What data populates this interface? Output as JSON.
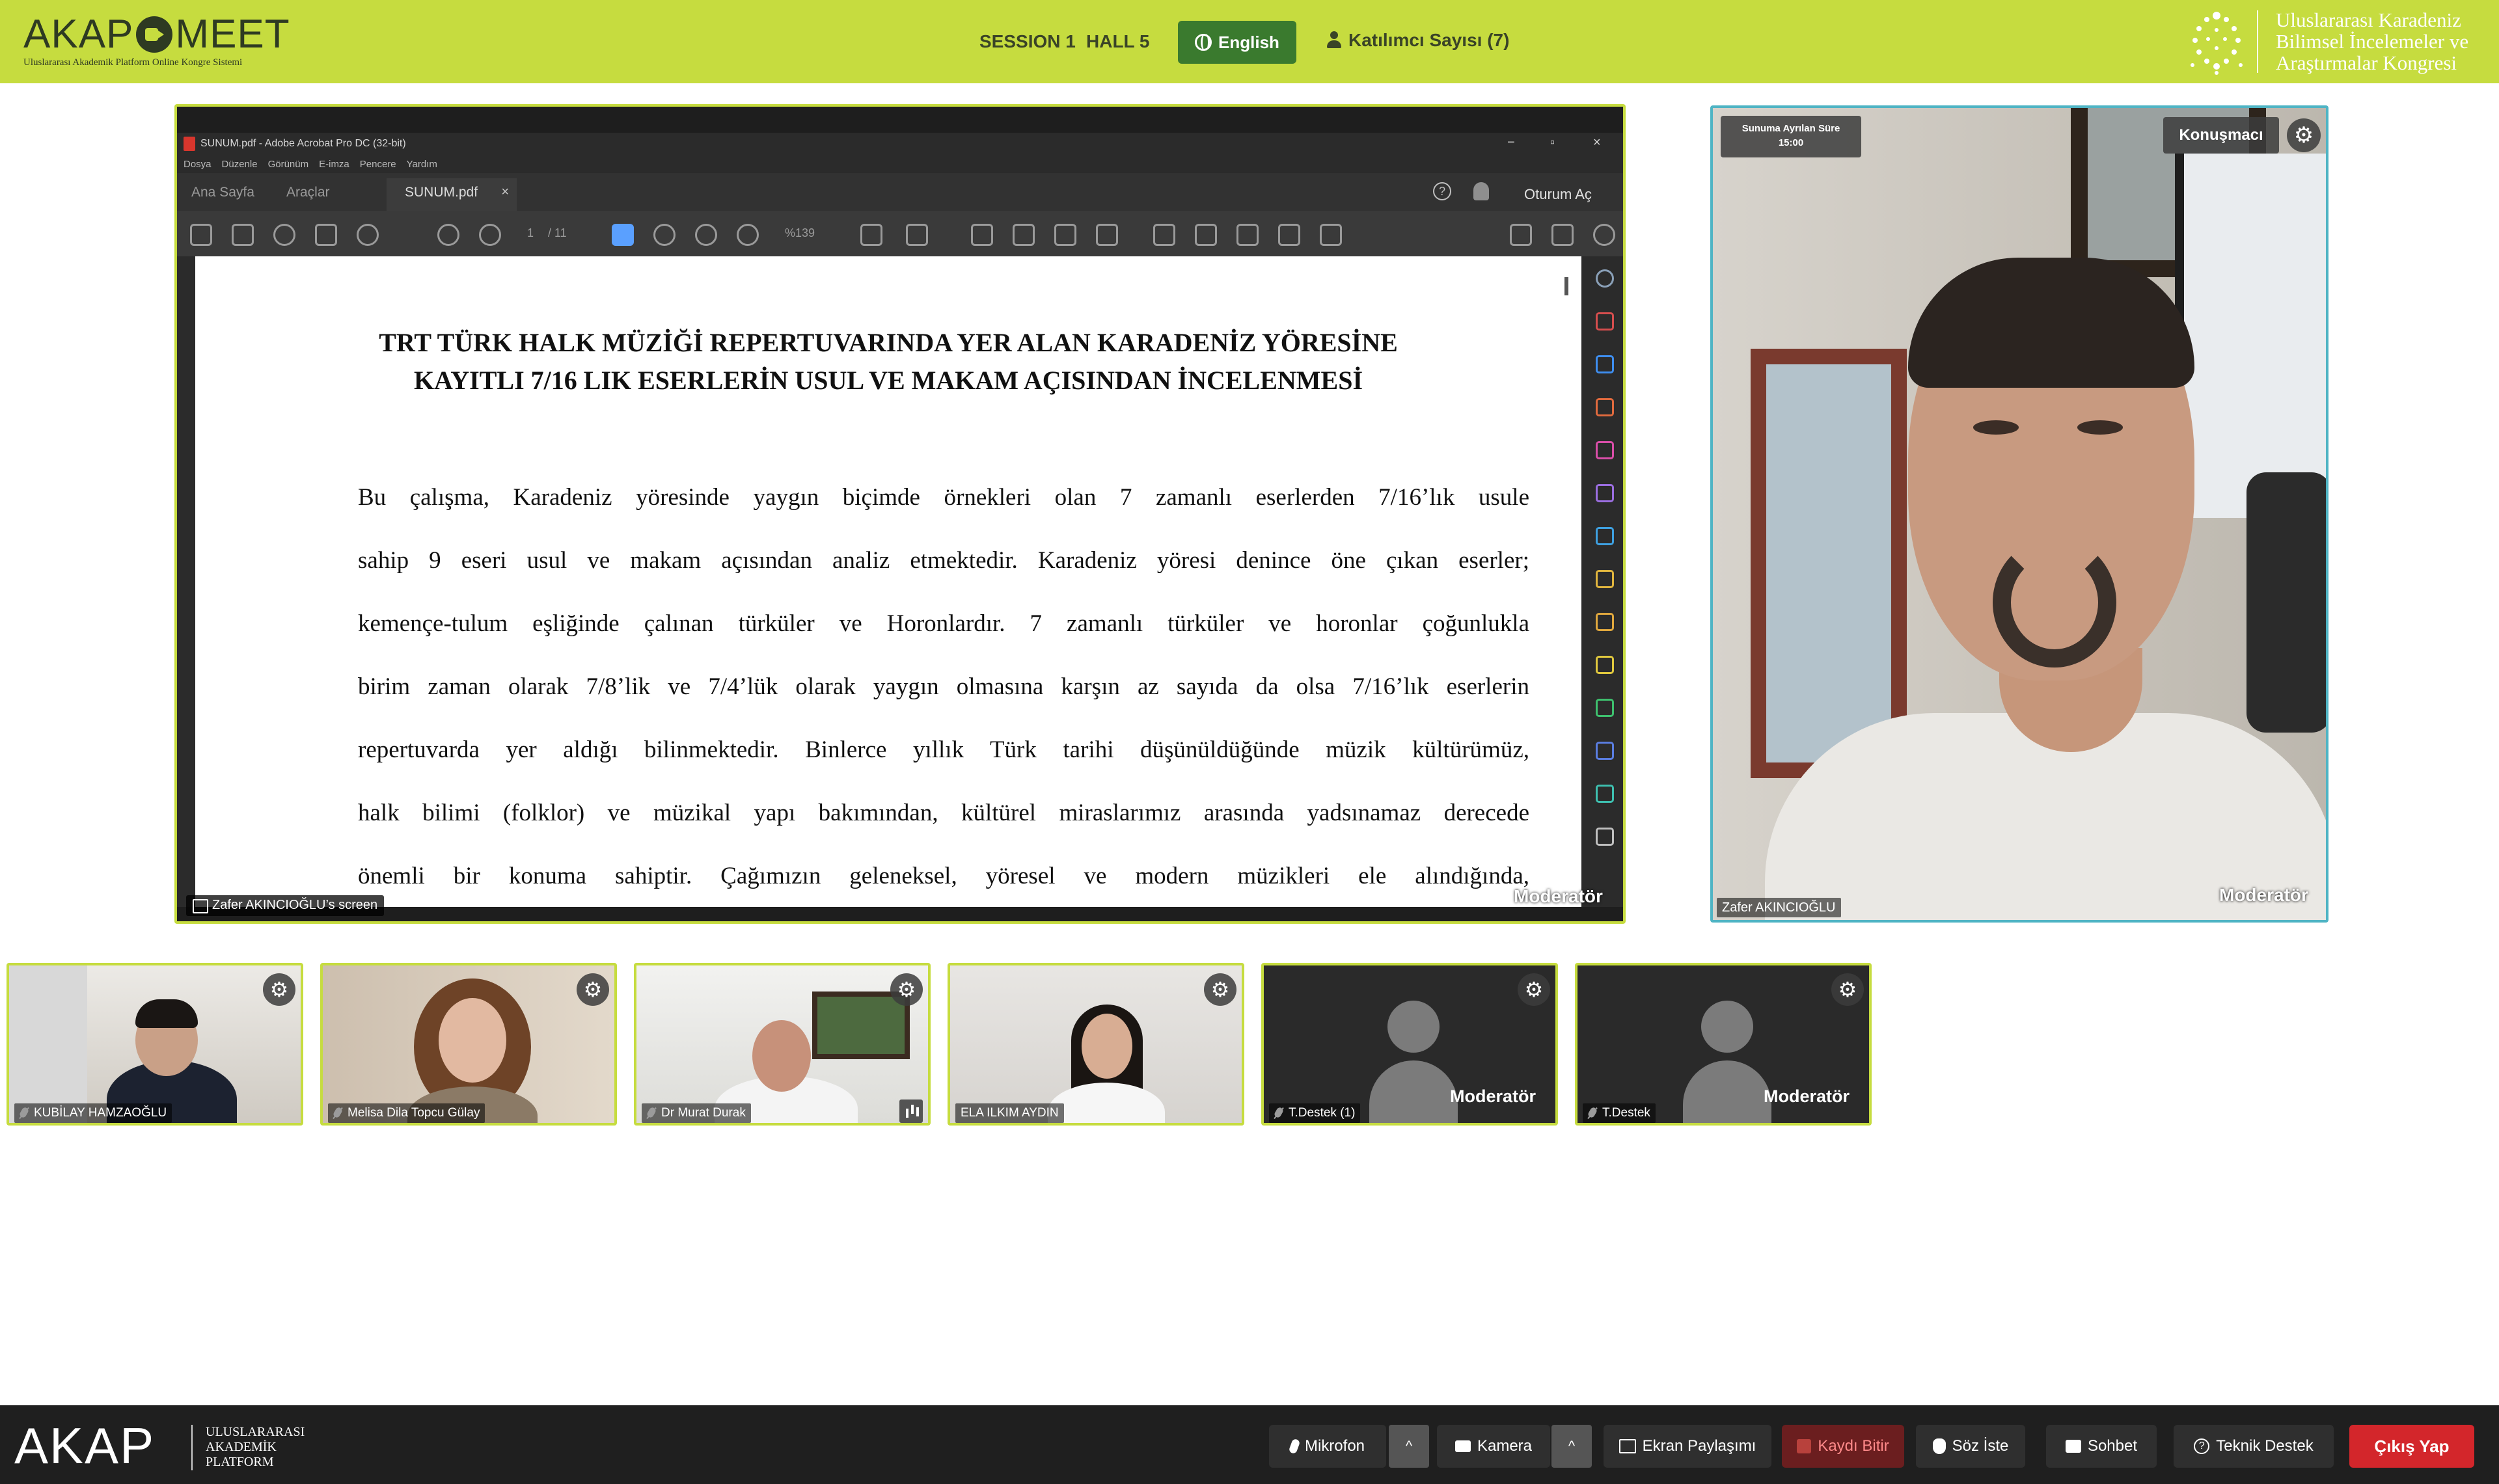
{
  "header": {
    "logo_text_left": "AKAP",
    "logo_text_right": "MEET",
    "logo_subtitle": "Uluslararası Akademik Platform Online Kongre Sistemi",
    "session": "SESSION 1",
    "hall": "HALL 5",
    "language_button": "English",
    "participants_label": "Katılımcı Sayısı (7)",
    "congress_title_line1": "Uluslararası Karadeniz",
    "congress_title_line2": "Bilimsel İncelemeler ve",
    "congress_title_line3": "Araştırmalar Kongresi",
    "accent_color": "#c6dc3f"
  },
  "screen_share": {
    "window_title": "SUNUM.pdf - Adobe Acrobat Pro DC (32-bit)",
    "menu": [
      "Dosya",
      "Düzenle",
      "Görünüm",
      "E-imza",
      "Pencere",
      "Yardım"
    ],
    "tabs": {
      "home": "Ana Sayfa",
      "tools": "Araçlar",
      "document": "SUNUM.pdf",
      "close": "×",
      "sign_in": "Oturum Aç"
    },
    "toolbar": {
      "page_current": "1",
      "page_total": "/ 11",
      "zoom": "%139"
    },
    "document": {
      "heading_line1": "TRT TÜRK HALK MÜZİĞİ REPERTUVARINDA YER ALAN KARADENİZ YÖRESİNE",
      "heading_line2": "KAYITLI 7/16 LIK ESERLERİN USUL VE MAKAM AÇISINDAN İNCELENMESİ",
      "body_lines": [
        "Bu çalışma, Karadeniz yöresinde yaygın biçimde örnekleri olan 7 zamanlı eserlerden 7/16’lık usule",
        "sahip 9 eseri usul ve makam açısından analiz etmektedir. Karadeniz yöresi denince öne çıkan eserler;",
        "kemençe-tulum eşliğinde çalınan türküler ve Horonlardır. 7 zamanlı türküler ve horonlar çoğunlukla",
        "birim zaman olarak 7/8’lik ve 7/4’lük olarak yaygın olmasına karşın az sayıda da olsa 7/16’lık eserlerin",
        "repertuvarda yer aldığı bilinmektedir. Binlerce yıllık Türk tarihi düşünüldüğünde müzik kültürümüz,",
        "halk bilimi (folklor) ve müzikal yapı bakımından, kültürel miraslarımız arasında yadsınamaz derecede",
        "önemli bir konuma sahiptir. Çağımızın geleneksel, yöresel ve modern müzikleri ele alındığında,"
      ]
    },
    "screen_label": "Zafer AKINCIOĞLU’s screen",
    "moderator_label": "Moderatör"
  },
  "speaker": {
    "time_label": "Sunuma Ayrılan Süre",
    "time_value": "15:00",
    "role_badge": "Konuşmacı",
    "name": "Zafer AKINCIOĞLU",
    "moderator_label": "Moderatör"
  },
  "participants": [
    {
      "name": "KUBİLAY HAMZAOĞLU",
      "moderator": ""
    },
    {
      "name": "Melisa Dila Topcu Gülay",
      "moderator": ""
    },
    {
      "name": "Dr Murat Durak",
      "moderator": ""
    },
    {
      "name": "ELA ILKIM AYDIN",
      "moderator": ""
    },
    {
      "name": "T.Destek (1)",
      "moderator": "Moderatör"
    },
    {
      "name": "T.Destek",
      "moderator": "Moderatör"
    }
  ],
  "bottom_bar": {
    "logo": "AKAP",
    "logo_sub_line1": "ULUSLARARASI",
    "logo_sub_line2": "AKADEMİK",
    "logo_sub_line3": "PLATFORM",
    "microphone": "Mikrofon",
    "camera": "Kamera",
    "screen_share": "Ekran Paylaşımı",
    "stop_recording": "Kaydı Bitir",
    "raise_hand": "Söz İste",
    "chat": "Sohbet",
    "tech_support": "Teknik Destek",
    "exit": "Çıkış Yap",
    "exit_color": "#d3262b"
  }
}
